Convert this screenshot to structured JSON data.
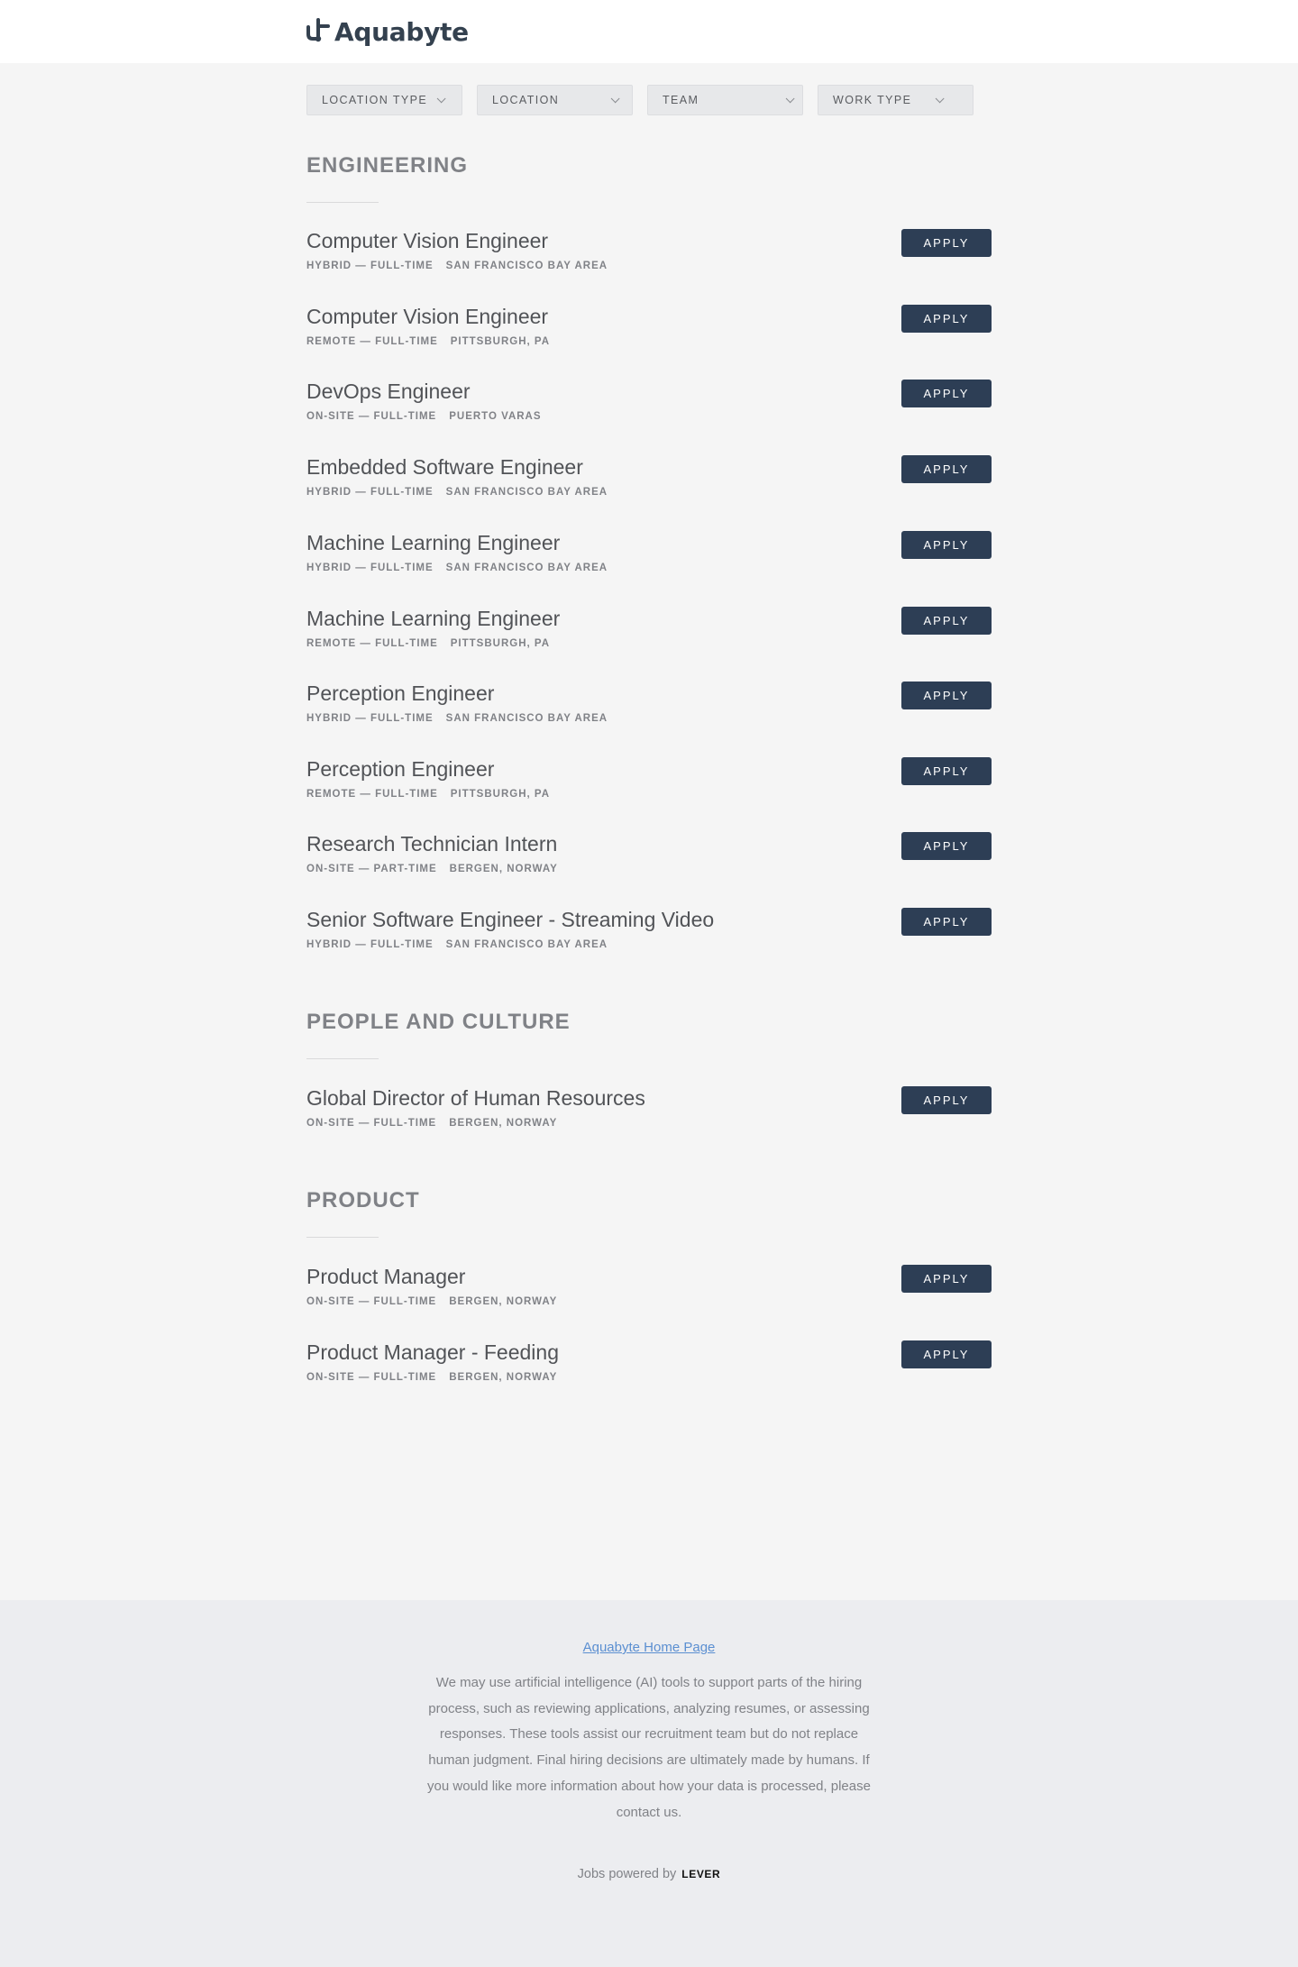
{
  "brand": {
    "name": "Aquabyte",
    "color": "#34414f"
  },
  "filters": [
    {
      "label": "LOCATION TYPE"
    },
    {
      "label": "LOCATION"
    },
    {
      "label": "TEAM"
    },
    {
      "label": "WORK TYPE"
    }
  ],
  "apply_label": "APPLY",
  "teams": [
    {
      "name": "ENGINEERING",
      "postings": [
        {
          "title": "Computer Vision Engineer",
          "work": "HYBRID — FULL-TIME",
          "location": "SAN FRANCISCO BAY AREA"
        },
        {
          "title": "Computer Vision Engineer",
          "work": "REMOTE — FULL-TIME",
          "location": "PITTSBURGH, PA"
        },
        {
          "title": "DevOps Engineer",
          "work": "ON-SITE — FULL-TIME",
          "location": "PUERTO VARAS"
        },
        {
          "title": "Embedded Software Engineer",
          "work": "HYBRID — FULL-TIME",
          "location": "SAN FRANCISCO BAY AREA"
        },
        {
          "title": "Machine Learning Engineer",
          "work": "HYBRID — FULL-TIME",
          "location": "SAN FRANCISCO BAY AREA"
        },
        {
          "title": "Machine Learning Engineer",
          "work": "REMOTE — FULL-TIME",
          "location": "PITTSBURGH, PA"
        },
        {
          "title": "Perception Engineer",
          "work": "HYBRID — FULL-TIME",
          "location": "SAN FRANCISCO BAY AREA"
        },
        {
          "title": "Perception Engineer",
          "work": "REMOTE — FULL-TIME",
          "location": "PITTSBURGH, PA"
        },
        {
          "title": "Research Technician Intern",
          "work": "ON-SITE — PART-TIME",
          "location": "BERGEN, NORWAY"
        },
        {
          "title": "Senior Software Engineer - Streaming Video",
          "work": "HYBRID — FULL-TIME",
          "location": "SAN FRANCISCO BAY AREA"
        }
      ]
    },
    {
      "name": "PEOPLE AND CULTURE",
      "postings": [
        {
          "title": "Global Director of Human Resources",
          "work": "ON-SITE — FULL-TIME",
          "location": "BERGEN, NORWAY"
        }
      ]
    },
    {
      "name": "PRODUCT",
      "postings": [
        {
          "title": "Product Manager",
          "work": "ON-SITE — FULL-TIME",
          "location": "BERGEN, NORWAY"
        },
        {
          "title": "Product Manager - Feeding",
          "work": "ON-SITE — FULL-TIME",
          "location": "BERGEN, NORWAY"
        }
      ]
    }
  ],
  "footer": {
    "home_link": "Aquabyte Home Page",
    "ai_notice": "We may use artificial intelligence (AI) tools to support parts of the hiring process, such as reviewing applications, analyzing resumes, or assessing responses. These tools assist our recruitment team but do not replace human judgment. Final hiring decisions are ultimately made by humans. If you would like more information about how your data is processed, please contact us.",
    "powered_by": "Jobs powered by",
    "lever": "LEVER",
    "link_color": "#5b8fd1"
  },
  "colors": {
    "apply_bg": "#2d3e55",
    "page_bg": "#f5f5f5",
    "footer_bg": "#ecedf0"
  }
}
